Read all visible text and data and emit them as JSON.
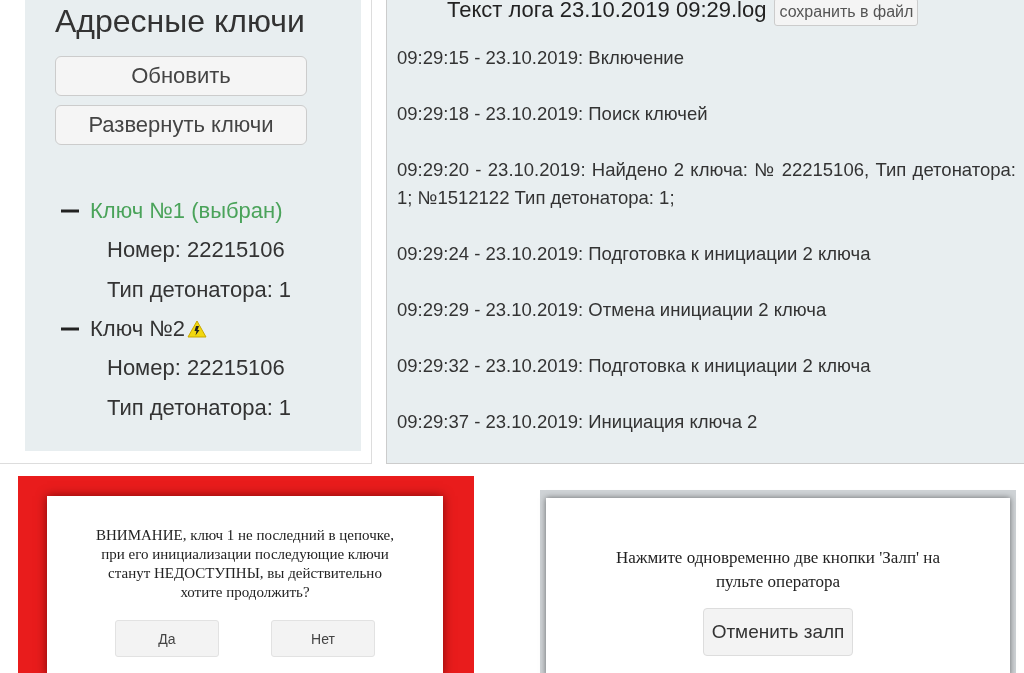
{
  "keys_panel": {
    "title": "Адресные ключи",
    "buttons": [
      "Обновить",
      "Развернуть ключи"
    ],
    "keys": [
      {
        "label": "Ключ №1 (выбран)",
        "selected": true,
        "warning": false,
        "expanded": true,
        "children": [
          "Номер: 22215106",
          "Тип детонатора: 1"
        ]
      },
      {
        "label": "Ключ №2",
        "selected": false,
        "warning": true,
        "expanded": true,
        "children": [
          "Номер: 22215106",
          "Тип детонатора: 1"
        ]
      }
    ]
  },
  "log_panel": {
    "title": "Текст лога 23.10.2019 09:29.log",
    "save_button": "сохранить в файл",
    "entries": [
      "09:29:15 - 23.10.2019: Включение",
      "09:29:18 - 23.10.2019: Поиск ключей",
      "09:29:20 - 23.10.2019: Найдено 2 ключа: № 22215106, Тип детонатора: 1; №1512122 Тип детонатора: 1;",
      "09:29:24 - 23.10.2019: Подготовка к инициации 2 ключа",
      "09:29:29 - 23.10.2019: Отмена инициации 2 ключа",
      "09:29:32 - 23.10.2019: Подготовка к инициации 2 ключа",
      "09:29:37 - 23.10.2019: Инициация ключа 2"
    ]
  },
  "dialogs": [
    {
      "kind": "danger",
      "message": "ВНИМАНИЕ, ключ 1 не последний в цепочке, при его инициализации последующие ключи станут НЕДОСТУПНЫ, вы действительно хотите продолжить?",
      "buttons": [
        "Да",
        "Нет"
      ]
    },
    {
      "kind": "plain",
      "message": "Нажмите одновременно две кнопки 'Залп' на пульте оператора",
      "buttons": [
        "Отменить залп"
      ]
    }
  ]
}
